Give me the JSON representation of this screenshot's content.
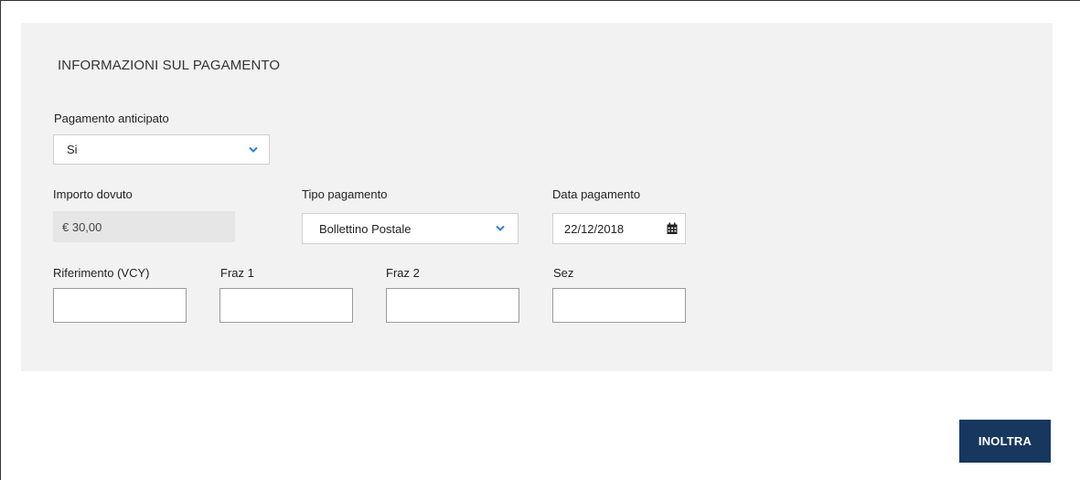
{
  "section": {
    "title": "INFORMAZIONI SUL PAGAMENTO"
  },
  "pagamento_anticipato": {
    "label": "Pagamento anticipato",
    "value": "Si",
    "icon": "chevron-down-icon"
  },
  "importo_dovuto": {
    "label": "Importo dovuto",
    "value": "€ 30,00"
  },
  "tipo_pagamento": {
    "label": "Tipo pagamento",
    "value": "Bollettino Postale",
    "icon": "chevron-down-icon"
  },
  "data_pagamento": {
    "label": "Data pagamento",
    "value": "22/12/2018",
    "icon": "calendar-icon"
  },
  "riferimento": {
    "label": "Riferimento (VCY)",
    "value": ""
  },
  "fraz1": {
    "label": "Fraz 1",
    "value": ""
  },
  "fraz2": {
    "label": "Fraz 2",
    "value": ""
  },
  "sez": {
    "label": "Sez",
    "value": ""
  },
  "submit": {
    "label": "INOLTRA"
  },
  "colors": {
    "panel_bg": "#f2f2f2",
    "button_bg": "#17375e",
    "chevron": "#2a7fd4",
    "readonly_bg": "#e6e6e6"
  }
}
